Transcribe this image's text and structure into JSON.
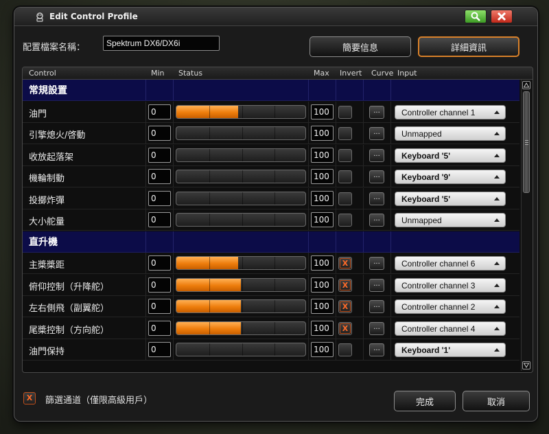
{
  "window": {
    "title": "Edit Control Profile",
    "icon": "joystick-icon"
  },
  "profile": {
    "name_label": "配置檔案名稱：",
    "name_value": "Spektrum DX6/DX6i"
  },
  "top_buttons": {
    "summary": "簡要信息",
    "detail": "詳細資訊"
  },
  "columns": {
    "control": "Control",
    "min": "Min",
    "status": "Status",
    "max": "Max",
    "invert": "Invert",
    "curve": "Curve",
    "input": "Input"
  },
  "sections": [
    {
      "title": "常規設置",
      "rows": [
        {
          "name": "油門",
          "min": "0",
          "max": "100",
          "level": 0.48,
          "inverted": false,
          "curve": "...",
          "input": "Controller channel 1",
          "input_bold": false
        },
        {
          "name": "引擎熄火/啓動",
          "min": "0",
          "max": "100",
          "level": 0,
          "inverted": false,
          "curve": "...",
          "input": "Unmapped",
          "input_bold": false
        },
        {
          "name": "收放起落架",
          "min": "0",
          "max": "100",
          "level": 0,
          "inverted": false,
          "curve": "...",
          "input": "Keyboard '5'",
          "input_bold": true
        },
        {
          "name": "機輪制動",
          "min": "0",
          "max": "100",
          "level": 0,
          "inverted": false,
          "curve": "...",
          "input": "Keyboard '9'",
          "input_bold": true
        },
        {
          "name": "投擲炸彈",
          "min": "0",
          "max": "100",
          "level": 0,
          "inverted": false,
          "curve": "...",
          "input": "Keyboard '5'",
          "input_bold": true
        },
        {
          "name": "大小舵量",
          "min": "0",
          "max": "100",
          "level": 0,
          "inverted": false,
          "curve": "...",
          "input": "Unmapped",
          "input_bold": false
        }
      ]
    },
    {
      "title": "直升機",
      "rows": [
        {
          "name": "主槳槳距",
          "min": "0",
          "max": "100",
          "level": 0.48,
          "inverted": true,
          "curve": "...",
          "input": "Controller channel 6",
          "input_bold": false
        },
        {
          "name": "俯仰控制（升降舵）",
          "min": "0",
          "max": "100",
          "level": 0.5,
          "inverted": true,
          "curve": "...",
          "input": "Controller channel 3",
          "input_bold": false
        },
        {
          "name": "左右側飛（副翼舵）",
          "min": "0",
          "max": "100",
          "level": 0.5,
          "inverted": true,
          "curve": "...",
          "input": "Controller channel 2",
          "input_bold": false
        },
        {
          "name": "尾槳控制（方向舵）",
          "min": "0",
          "max": "100",
          "level": 0.5,
          "inverted": true,
          "curve": "...",
          "input": "Controller channel 4",
          "input_bold": false
        },
        {
          "name": "油門保持",
          "min": "0",
          "max": "100",
          "level": 0,
          "inverted": false,
          "curve": "...",
          "input": "Keyboard '1'",
          "input_bold": true
        }
      ]
    }
  ],
  "footer": {
    "filter_label": "篩選通道（僅限高級用戶）",
    "filter_checked": true,
    "done": "完成",
    "cancel": "取消"
  },
  "colors": {
    "accent": "#ee7d0c",
    "section_bg": "#0c0c48",
    "invert_x": "#ff6a28"
  }
}
